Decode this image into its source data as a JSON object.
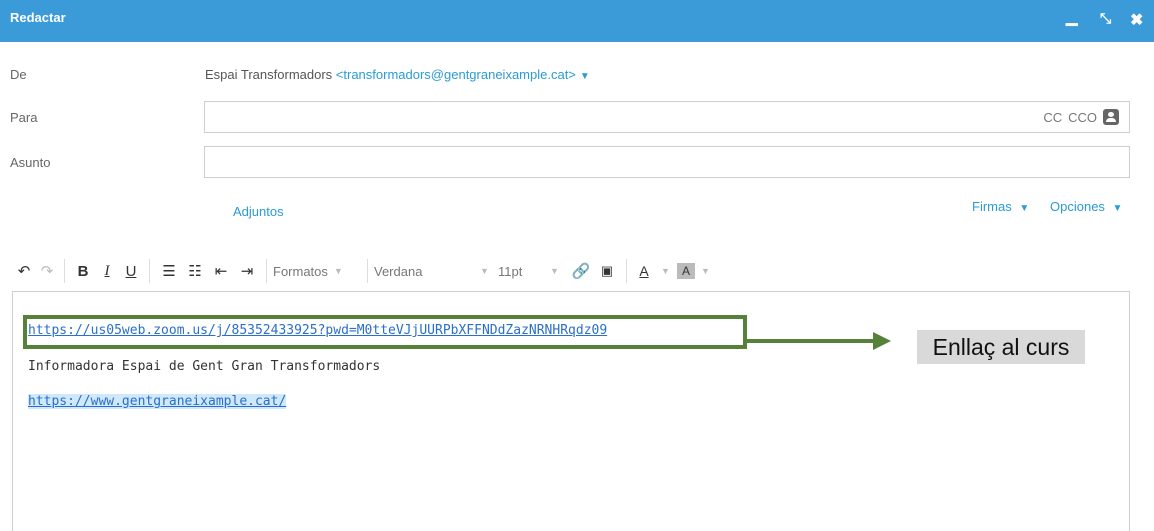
{
  "window": {
    "title": "Redactar",
    "minimize_icon": "minimize-icon",
    "expand_icon": "expand-icon",
    "close_icon": "close-icon"
  },
  "form": {
    "from_label": "De",
    "from_name": "Espai Transformadors",
    "from_email": "<transformadors@gentgraneixample.cat>",
    "to_label": "Para",
    "to_value": "",
    "cc_label": "CC",
    "bcc_label": "CCO",
    "subject_label": "Asunto",
    "subject_value": "",
    "attachments_label": "Adjuntos",
    "signatures_label": "Firmas",
    "options_label": "Opciones"
  },
  "toolbar": {
    "bold": "B",
    "italic": "I",
    "underline": "U",
    "formats": "Formatos",
    "font_family": "Verdana",
    "font_size": "11pt",
    "text_color": "A",
    "highlight_color": "A"
  },
  "body": {
    "line1": "https://us05web.zoom.us/j/85352433925?pwd=M0tteVJjUURPbXFFNDdZazNRNHRqdz09",
    "line2": "Informadora Espai de Gent Gran Transformadors",
    "line3": "https://www.gentgraneixample.cat/"
  },
  "annotation": {
    "callout_text": "Enllaç al curs",
    "color": "#55813a"
  },
  "colors": {
    "accent": "#3b9bd9",
    "link": "#2a9bd5"
  }
}
